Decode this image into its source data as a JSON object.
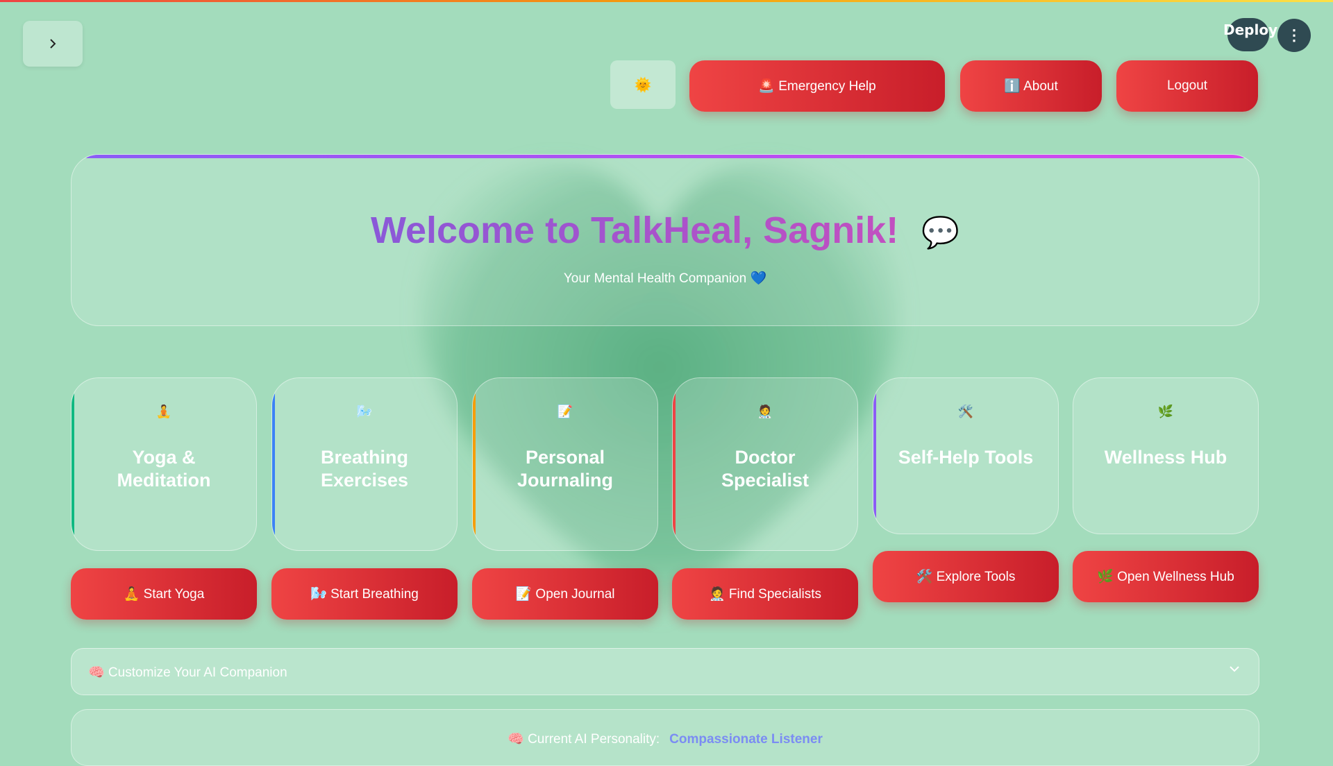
{
  "header": {
    "deploy_label": "Deploy",
    "menu_icon": "⋮",
    "theme_icon": "🌞",
    "emergency_label": "🚨 Emergency Help",
    "about_label": "ℹ️ About",
    "logout_label": "Logout"
  },
  "hero": {
    "title": "Welcome to TalkHeal, Sagnik!",
    "title_icon": "💬",
    "subtitle": "Your Mental Health Companion 💙"
  },
  "cards": [
    {
      "emoji": "🧘",
      "title": "Yoga & Meditation",
      "button": "🧘 Start Yoga",
      "accent": "#10b981"
    },
    {
      "emoji": "🌬️",
      "title": "Breathing Exercises",
      "button": "🌬️ Start Breathing",
      "accent": "#3b82f6"
    },
    {
      "emoji": "📝",
      "title": "Personal Journaling",
      "button": "📝 Open Journal",
      "accent": "#f59e0b"
    },
    {
      "emoji": "🧑‍⚕️",
      "title": "Doctor Specialist",
      "button": "🧑‍⚕️ Find Specialists",
      "accent": "#ef4444"
    },
    {
      "emoji": "🛠️",
      "title": "Self-Help Tools",
      "button": "🛠️ Explore Tools",
      "accent": "#8b5cf6"
    },
    {
      "emoji": "🌿",
      "title": "Wellness Hub",
      "button": "🌿 Open Wellness Hub",
      "accent": ""
    }
  ],
  "customize": {
    "label": "🧠 Customize Your AI Companion"
  },
  "personality": {
    "label": "🧠 Current AI Personality:",
    "value": "Compassionate Listener"
  },
  "colors": {
    "background": "#a3dcbc",
    "button_red": "#dc2626",
    "title_purple": "#9b4fc9",
    "personality_value": "#7b8cf3"
  }
}
